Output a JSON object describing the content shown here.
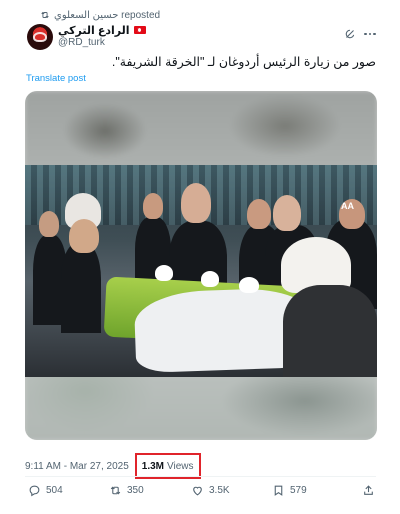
{
  "repost": {
    "text": "حسين السعلوي reposted"
  },
  "author": {
    "display_name": "الرادع التركي",
    "handle": "@RD_turk"
  },
  "post": {
    "text": "صور من زيارة الرئيس أردوغان لـ \"الخرقة الشريفة\".",
    "translate_label": "Translate post"
  },
  "media": {
    "watermark": "AA"
  },
  "meta": {
    "timestamp": "9:11 AM - Mar 27, 2025",
    "views_count": "1.3M",
    "views_label": "Views"
  },
  "actions": {
    "replies": "504",
    "reposts": "350",
    "likes": "3.5K",
    "bookmarks": "579"
  },
  "colors": {
    "accent": "#1d9bf0",
    "highlight_box": "#e0242b",
    "muted": "#536471"
  }
}
